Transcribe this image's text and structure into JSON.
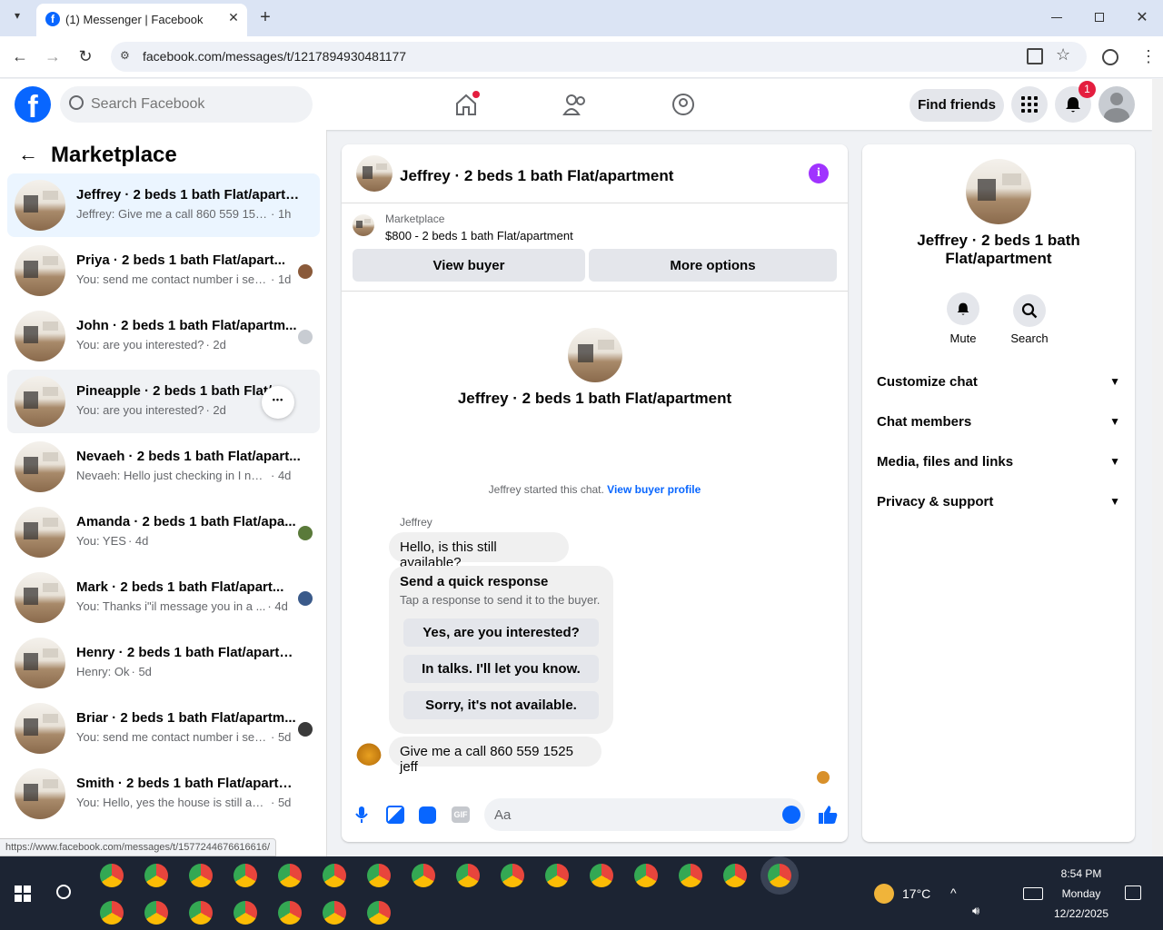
{
  "browser": {
    "tab_title": "(1) Messenger | Facebook",
    "url": "facebook.com/messages/t/1217894930481177",
    "status_url": "https://www.facebook.com/messages/t/1577244676616616/"
  },
  "header": {
    "search_placeholder": "Search Facebook",
    "find_friends": "Find friends",
    "notif_count": "1"
  },
  "left": {
    "title": "Marketplace",
    "conversations": [
      {
        "name": "Jeffrey · 2 beds 1 bath Flat/apartm...",
        "snippet": "Jeffrey: Give me a call 860 559 1525 jeff",
        "time": "· 1h",
        "mini": "#ffffff"
      },
      {
        "name": "Priya · 2 beds 1 bath Flat/apart...",
        "snippet": "You: send me contact number i sen...",
        "time": "· 1d",
        "mini": "#8a5a3a"
      },
      {
        "name": "John · 2 beds 1 bath Flat/apartm...",
        "snippet": "You: are you interested?",
        "time": "· 2d",
        "mini": "#c8ccd2"
      },
      {
        "name": "Pineapple · 2 beds 1 bath Flat/a...",
        "snippet": "You: are you interested?",
        "time": "· 2d",
        "mini": ""
      },
      {
        "name": "Nevaeh · 2 beds 1 bath Flat/apart...",
        "snippet": "Nevaeh: Hello just checking in I never...",
        "time": "· 4d",
        "mini": ""
      },
      {
        "name": "Amanda · 2 beds 1 bath Flat/apa...",
        "snippet": "You: YES",
        "time": "· 4d",
        "mini": "#5a7a3a"
      },
      {
        "name": "Mark · 2 beds 1 bath Flat/apart...",
        "snippet": "You: Thanks i\"il message you in a ...",
        "time": "· 4d",
        "mini": "#3a5a8a"
      },
      {
        "name": "Henry · 2 beds 1 bath Flat/apartme...",
        "snippet": "Henry: Ok",
        "time": "· 5d",
        "mini": ""
      },
      {
        "name": "Briar · 2 beds 1 bath Flat/apartm...",
        "snippet": "You: send me contact number i sen...",
        "time": "· 5d",
        "mini": "#3a3a3a"
      },
      {
        "name": "Smith · 2 beds 1 bath Flat/apartment",
        "snippet": "You: Hello, yes the house is still availa...",
        "time": "· 5d",
        "mini": ""
      }
    ]
  },
  "chat": {
    "title": "Jeffrey · 2 beds 1 bath Flat/apartment",
    "listing_source": "Marketplace",
    "listing_price": "$800 - 2 beds 1 bath Flat/apartment",
    "view_buyer": "View buyer",
    "more_options": "More options",
    "center_title": "Jeffrey · 2 beds 1 bath Flat/apartment",
    "started_text": "Jeffrey started this chat.",
    "view_buyer_profile": "View buyer profile",
    "sender": "Jeffrey",
    "msg1": "Hello, is this still available?",
    "quick_title": "Send a quick response",
    "quick_sub": "Tap a response to send it to the buyer.",
    "quick_responses": [
      "Yes, are you interested?",
      "In talks. I'll let you know.",
      "Sorry, it's not available."
    ],
    "msg2": "Give me a call 860 559 1525 jeff",
    "input_placeholder": "Aa"
  },
  "info": {
    "title": "Jeffrey · 2 beds 1 bath Flat/apartment",
    "mute": "Mute",
    "search": "Search",
    "sections": [
      "Customize chat",
      "Chat members",
      "Media, files and links",
      "Privacy & support"
    ]
  },
  "taskbar": {
    "temp": "17°C",
    "time": "8:54 PM",
    "day": "Monday",
    "date": "12/22/2025"
  },
  "colors": {
    "fb_blue": "#0866ff",
    "badge_red": "#e41e3f",
    "purple_info": "#a033ff"
  }
}
